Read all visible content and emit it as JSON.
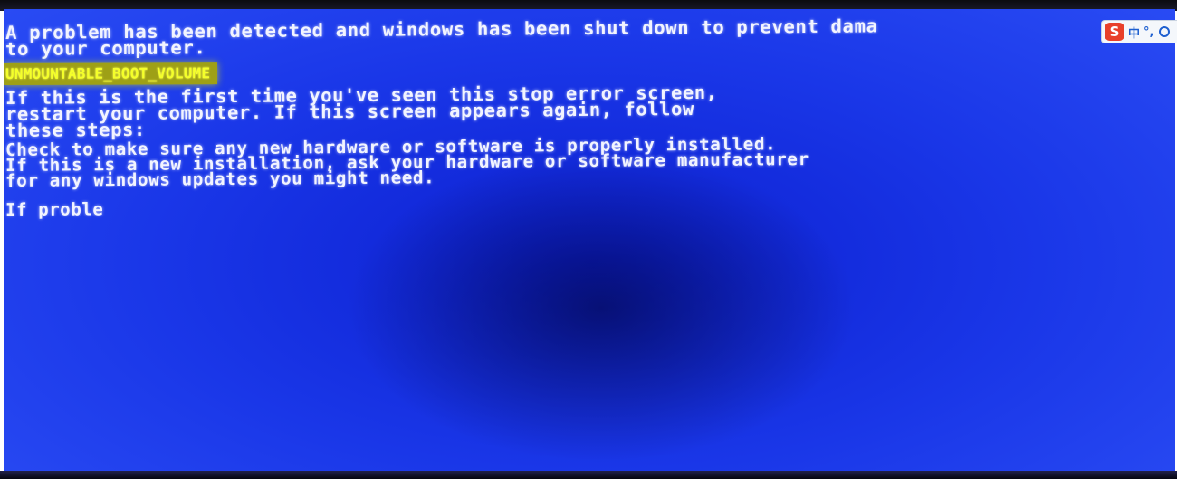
{
  "bsod": {
    "intro_line1": "A problem has been detected and windows has been shut down to prevent dama",
    "intro_line2": "to your computer.",
    "stop_code": "UNMOUNTABLE_BOOT_VOLUME",
    "advice_line1": "If this is the first time you've seen this stop error screen,",
    "advice_line2": "restart your computer. If this screen appears again, follow",
    "advice_line3": "these steps:",
    "check_line1": "Check to make sure any new hardware or software is properly installed.",
    "check_line2": "If this is a new installation, ask your hardware or software manufacturer",
    "check_line3": "for any windows updates you might need.",
    "partial_line": "If proble"
  },
  "ime_toolbar": {
    "logo_letter": "S",
    "mode_label": "中",
    "punct_label": "°,",
    "logo_color": "#e8402a",
    "accent_color": "#1d5fd0"
  },
  "colors": {
    "screen_blue": "#1a37e8",
    "text_white": "#f2f4ff",
    "stop_code_yellow": "#f4ff2a"
  }
}
